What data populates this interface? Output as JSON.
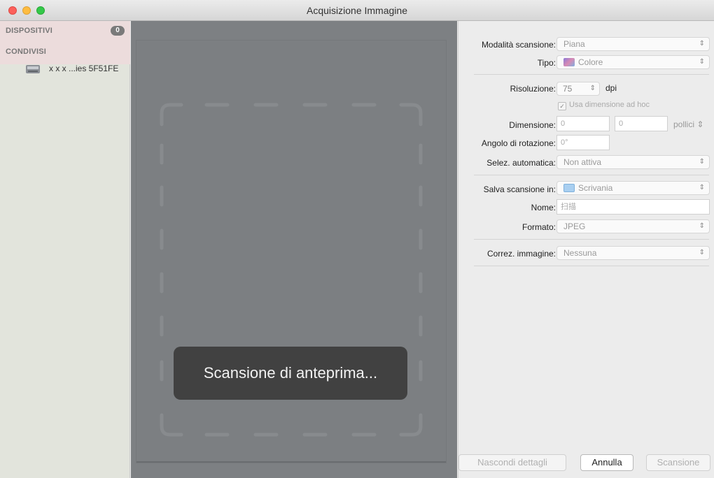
{
  "window": {
    "title": "Acquisizione Immagine"
  },
  "sidebar": {
    "devices_header": "DISPOSITIVI",
    "devices_count": "0",
    "shared_header": "CONDIVISI",
    "device_name": "x x x ...ies 5F51FE"
  },
  "preview": {
    "status": "Scansione di anteprima..."
  },
  "settings": {
    "mode_label": "Modalità scansione:",
    "mode_value": "Piana",
    "type_label": "Tipo:",
    "type_value": "Colore",
    "resolution_label": "Risoluzione:",
    "resolution_value": "75",
    "resolution_unit": "dpi",
    "custom_size_label": "Usa dimensione ad hoc",
    "custom_size_checked": true,
    "size_label": "Dimensione:",
    "size_width": "0",
    "size_height": "0",
    "size_unit": "pollici",
    "rotation_label": "Angolo di rotazione:",
    "rotation_value": "0°",
    "autoselect_label": "Selez. automatica:",
    "autoselect_value": "Non attiva",
    "save_label": "Salva scansione in:",
    "save_value": "Scrivania",
    "name_label": "Nome:",
    "name_value": "扫描",
    "format_label": "Formato:",
    "format_value": "JPEG",
    "correction_label": "Correz. immagine:",
    "correction_value": "Nessuna"
  },
  "buttons": {
    "hide_details": "Nascondi dettagli",
    "cancel": "Annulla",
    "scan": "Scansione"
  },
  "colors": {
    "hud_bg": "#3c3c3c",
    "preview_bg": "#7d8083",
    "sidebar_bg": "#e2e4dc"
  },
  "icons": {
    "device": "scanner-icon",
    "type": "color-swatch-icon",
    "folder": "folder-icon",
    "popup": "up-down-arrows-icon"
  }
}
